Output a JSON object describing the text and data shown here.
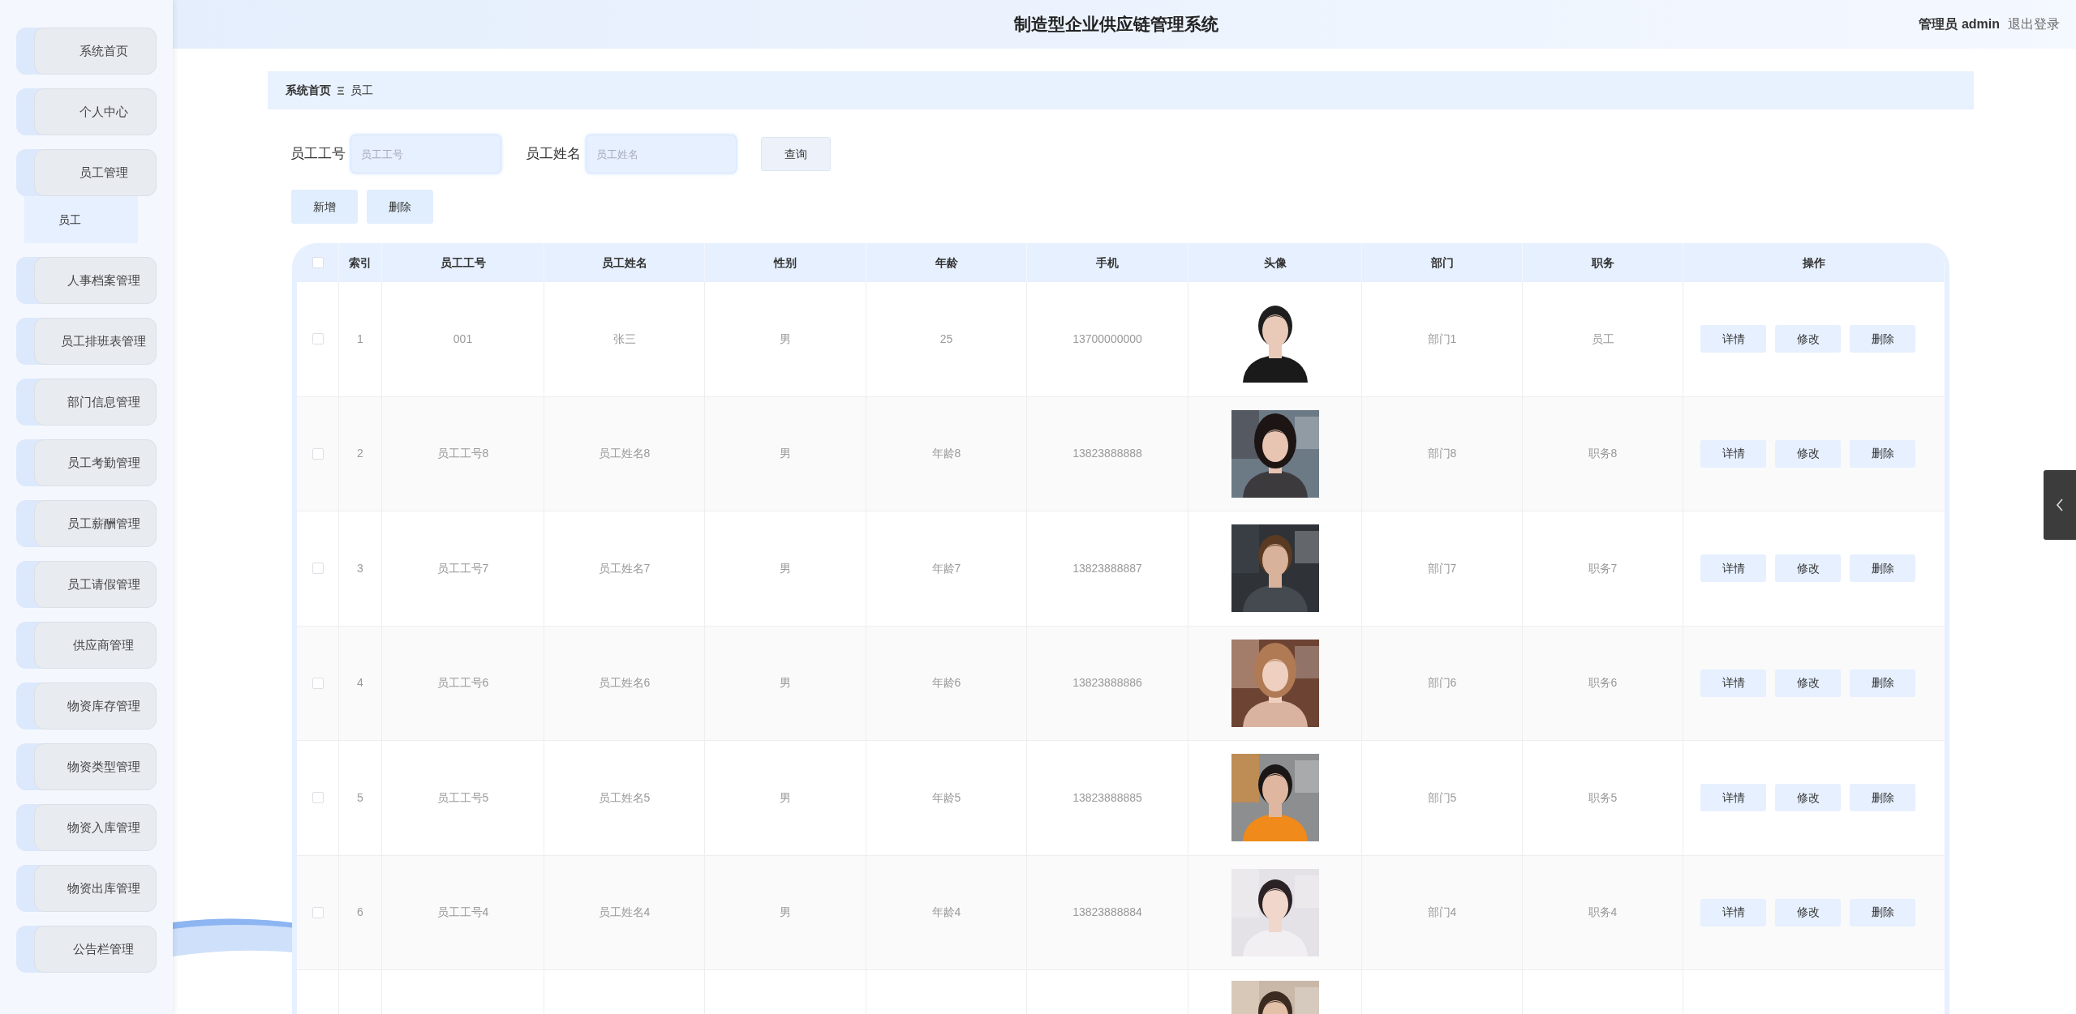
{
  "header": {
    "title": "制造型企业供应链管理系统",
    "user": "管理员 admin",
    "logout": "退出登录"
  },
  "sidebar": {
    "items": [
      {
        "label": "系统首页"
      },
      {
        "label": "个人中心"
      },
      {
        "label": "员工管理",
        "children": [
          {
            "label": "员工",
            "selected": true
          }
        ]
      },
      {
        "label": "人事档案管理"
      },
      {
        "label": "员工排班表管理"
      },
      {
        "label": "部门信息管理"
      },
      {
        "label": "员工考勤管理"
      },
      {
        "label": "员工薪酬管理"
      },
      {
        "label": "员工请假管理"
      },
      {
        "label": "供应商管理"
      },
      {
        "label": "物资库存管理"
      },
      {
        "label": "物资类型管理"
      },
      {
        "label": "物资入库管理"
      },
      {
        "label": "物资出库管理"
      },
      {
        "label": "公告栏管理"
      }
    ]
  },
  "breadcrumb": [
    "系统首页",
    "员工"
  ],
  "search": {
    "fields": [
      {
        "label": "员工工号",
        "placeholder": "员工工号"
      },
      {
        "label": "员工姓名",
        "placeholder": "员工姓名"
      }
    ],
    "button": "查询"
  },
  "toolbar": [
    "新增",
    "删除"
  ],
  "table": {
    "select_all": false,
    "columns": [
      "索引",
      "员工工号",
      "员工姓名",
      "性别",
      "年龄",
      "手机",
      "头像",
      "部门",
      "职务",
      "操作"
    ],
    "rows": [
      {
        "checked": false,
        "cells": [
          "1",
          "001",
          "张三",
          "男",
          "25",
          "13700000000"
        ],
        "avatar": {
          "kind": "picture"
        },
        "cells_after": [
          "部门1",
          "员工"
        ],
        "actions": [
          "详情",
          "修改",
          "删除"
        ]
      },
      {
        "checked": false,
        "cells": [
          "2",
          "员工工号8",
          "员工姓名8",
          "男",
          "年龄8",
          "13823888888"
        ],
        "avatar": {
          "kind": "picture"
        },
        "cells_after": [
          "部门8",
          "职务8"
        ],
        "actions": [
          "详情",
          "修改",
          "删除"
        ]
      },
      {
        "checked": false,
        "cells": [
          "3",
          "员工工号7",
          "员工姓名7",
          "男",
          "年龄7",
          "13823888887"
        ],
        "avatar": {
          "kind": "picture"
        },
        "cells_after": [
          "部门7",
          "职务7"
        ],
        "actions": [
          "详情",
          "修改",
          "删除"
        ]
      },
      {
        "checked": false,
        "cells": [
          "4",
          "员工工号6",
          "员工姓名6",
          "男",
          "年龄6",
          "13823888886"
        ],
        "avatar": {
          "kind": "picture"
        },
        "cells_after": [
          "部门6",
          "职务6"
        ],
        "actions": [
          "详情",
          "修改",
          "删除"
        ]
      },
      {
        "checked": false,
        "cells": [
          "5",
          "员工工号5",
          "员工姓名5",
          "男",
          "年龄5",
          "13823888885"
        ],
        "avatar": {
          "kind": "picture"
        },
        "cells_after": [
          "部门5",
          "职务5"
        ],
        "actions": [
          "详情",
          "修改",
          "删除"
        ]
      },
      {
        "checked": false,
        "cells": [
          "6",
          "员工工号4",
          "员工姓名4",
          "男",
          "年龄4",
          "13823888884"
        ],
        "avatar": {
          "kind": "picture"
        },
        "cells_after": [
          "部门4",
          "职务4"
        ],
        "actions": [
          "详情",
          "修改",
          "删除"
        ]
      },
      {
        "avatar": {
          "kind": "picture"
        }
      }
    ]
  }
}
